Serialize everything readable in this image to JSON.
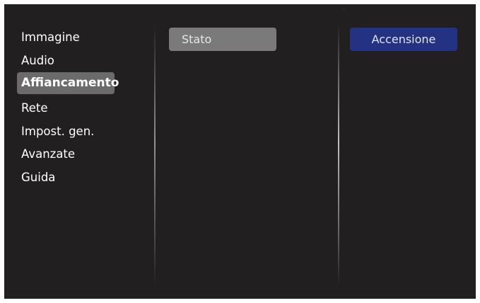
{
  "menu": {
    "items": [
      {
        "label": "Immagine"
      },
      {
        "label": "Audio"
      },
      {
        "label": "Affiancamento"
      },
      {
        "label": "Rete"
      },
      {
        "label": "Impost. gen."
      },
      {
        "label": "Avanzate"
      },
      {
        "label": "Guida"
      }
    ],
    "selected_index": 2
  },
  "submenu": {
    "items": [
      {
        "label": "Stato"
      }
    ]
  },
  "value": {
    "label": "Accensione"
  },
  "colors": {
    "background": "#221f20",
    "selected_menu": "#6b6b6b",
    "submenu_highlight": "#7a7a7a",
    "value_highlight": "#233283",
    "text": "#ffffff"
  }
}
